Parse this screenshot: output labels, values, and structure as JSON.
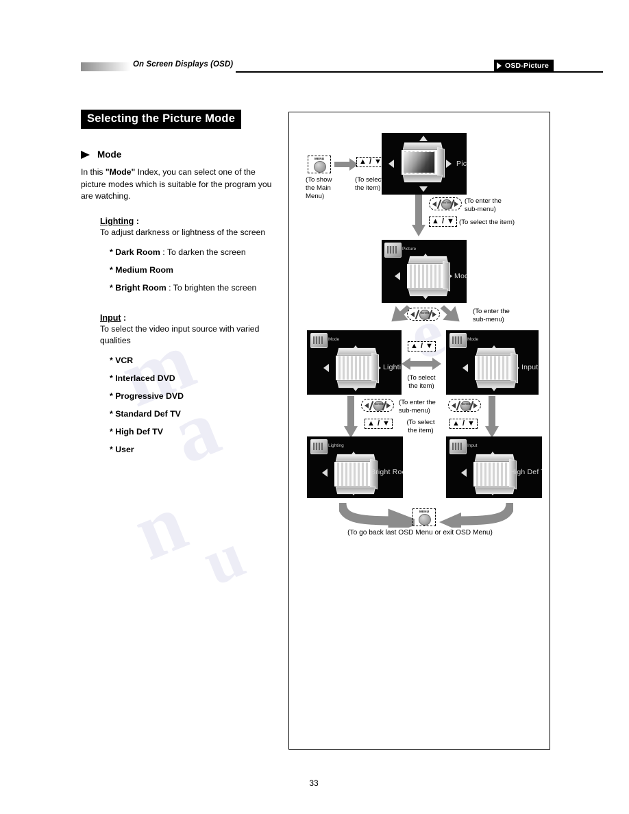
{
  "header": {
    "section_title": "On Screen Displays (OSD)",
    "tag_label": "OSD-Picture",
    "tag_icon": "triangle-right-icon"
  },
  "page_number": "33",
  "left_column": {
    "section_title": "Selecting the Picture Mode",
    "bullet_icon": "arrow-right-bullet-icon",
    "bullet_heading": "Mode",
    "intro": {
      "before": "In this ",
      "emphasis": "\"Mode\"",
      "after": " Index, you can select one of the picture modes which is suitable for the program you are watching."
    },
    "groups": [
      {
        "label": "Lighting",
        "label_suffix": " :",
        "description": "To adjust darkness or lightness of the screen",
        "options": [
          {
            "marker": "*",
            "name": "Dark Room",
            "desc": " : To darken the screen"
          },
          {
            "marker": "*",
            "name": "Medium Room",
            "desc": ""
          },
          {
            "marker": "*",
            "name": "Bright Room",
            "desc": " : To brighten the screen"
          }
        ]
      },
      {
        "label": "Input",
        "label_suffix": " :",
        "description": "To select the video input source with varied qualities",
        "options": [
          {
            "marker": "*",
            "name": "VCR",
            "desc": ""
          },
          {
            "marker": "*",
            "name": "Interlaced DVD",
            "desc": ""
          },
          {
            "marker": "*",
            "name": "Progressive DVD",
            "desc": ""
          },
          {
            "marker": "*",
            "name": "Standard Def TV",
            "desc": ""
          },
          {
            "marker": "*",
            "name": "High Def TV",
            "desc": ""
          },
          {
            "marker": "*",
            "name": "User",
            "desc": ""
          }
        ]
      }
    ]
  },
  "diagram": {
    "keys": {
      "menu_label": "MENU",
      "updown_label": "▲ / ▼",
      "enter_label": "ENTER"
    },
    "captions": {
      "show_main_menu": "(To show\nthe Main\nMenu)",
      "select_item_short": "(To select\nthe item)",
      "enter_submenu": "(To enter the\nsub-menu)",
      "select_item_inline": "(To select the item)",
      "select_item_two_line": "(To select\nthe item)",
      "go_back": "(To go back last OSD Menu or exit OSD Menu)"
    },
    "panels": [
      {
        "id": "picture",
        "title": "Picture",
        "breadcrumb": "",
        "crumb_icon": ""
      },
      {
        "id": "mode",
        "title": "Mode",
        "breadcrumb": "Picture",
        "crumb_icon": "menu-thumb-icon"
      },
      {
        "id": "lighting",
        "title": "Lighting",
        "breadcrumb": "Mode",
        "crumb_icon": "menu-thumb-icon"
      },
      {
        "id": "input",
        "title": "Input",
        "breadcrumb": "Mode",
        "crumb_icon": "menu-thumb-icon"
      },
      {
        "id": "brightroom",
        "title": "Bright Room",
        "breadcrumb": "Lighting",
        "crumb_icon": "menu-thumb-icon"
      },
      {
        "id": "highdeftv",
        "title": "High Def TV",
        "breadcrumb": "Input",
        "crumb_icon": "menu-thumb-icon"
      }
    ]
  },
  "colors": {
    "accent": "#000000",
    "panel_bg": "#050505",
    "arrow_grey": "#8c8c8c"
  }
}
